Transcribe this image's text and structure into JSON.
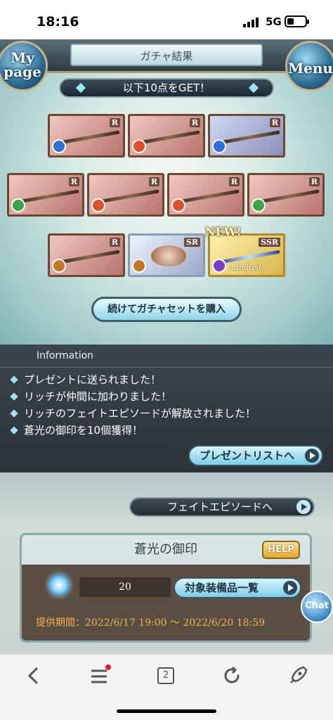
{
  "status_bar": {
    "time": "18:16",
    "network": "5G"
  },
  "header": {
    "title": "ガチャ結果",
    "my_page_line1": "My",
    "my_page_line2": "page",
    "menu_label": "Menu"
  },
  "banner": {
    "text": "以下10点をGET！"
  },
  "results": [
    {
      "rarity": "R",
      "element": "water",
      "element_color": "#2f6fd8"
    },
    {
      "rarity": "R",
      "element": "fire",
      "element_color": "#e0502a"
    },
    {
      "rarity": "R",
      "element": "water",
      "element_color": "#2f6fd8"
    },
    {
      "rarity": "R",
      "element": "wind",
      "element_color": "#3aa54a"
    },
    {
      "rarity": "R",
      "element": "fire",
      "element_color": "#e0502a"
    },
    {
      "rarity": "R",
      "element": "fire",
      "element_color": "#e0502a"
    },
    {
      "rarity": "R",
      "element": "wind",
      "element_color": "#3aa54a"
    },
    {
      "rarity": "R",
      "element": "earth",
      "element_color": "#c8742a"
    },
    {
      "rarity": "SR",
      "element": "earth",
      "element_color": "#c8742a"
    },
    {
      "rarity": "SSR",
      "element": "dark",
      "element_color": "#7a3fc1",
      "badge": "NEW!",
      "limited_label": "Limited"
    }
  ],
  "buy_button": {
    "label": "続けてガチャセットを購入"
  },
  "information": {
    "heading": "Information",
    "messages": [
      "プレゼントに送られました！",
      "リッチが仲間に加わりました！",
      "リッチのフェイトエピソードが解放されました！",
      "蒼光の御印を10個獲得！"
    ],
    "present_list_button": "プレゼントリストへ"
  },
  "fate_episode_button": "フェイトエピソードへ",
  "seal": {
    "name": "蒼光の御印",
    "help_label": "HELP",
    "quantity": "20",
    "equipment_button": "対象装備品一覧",
    "period": "提供期間：2022/6/17 19:00 〜 2022/6/20 18:59"
  },
  "chat_label": "Chat",
  "browser_nav": {
    "tab_count": "2",
    "menu_has_notification": true
  }
}
